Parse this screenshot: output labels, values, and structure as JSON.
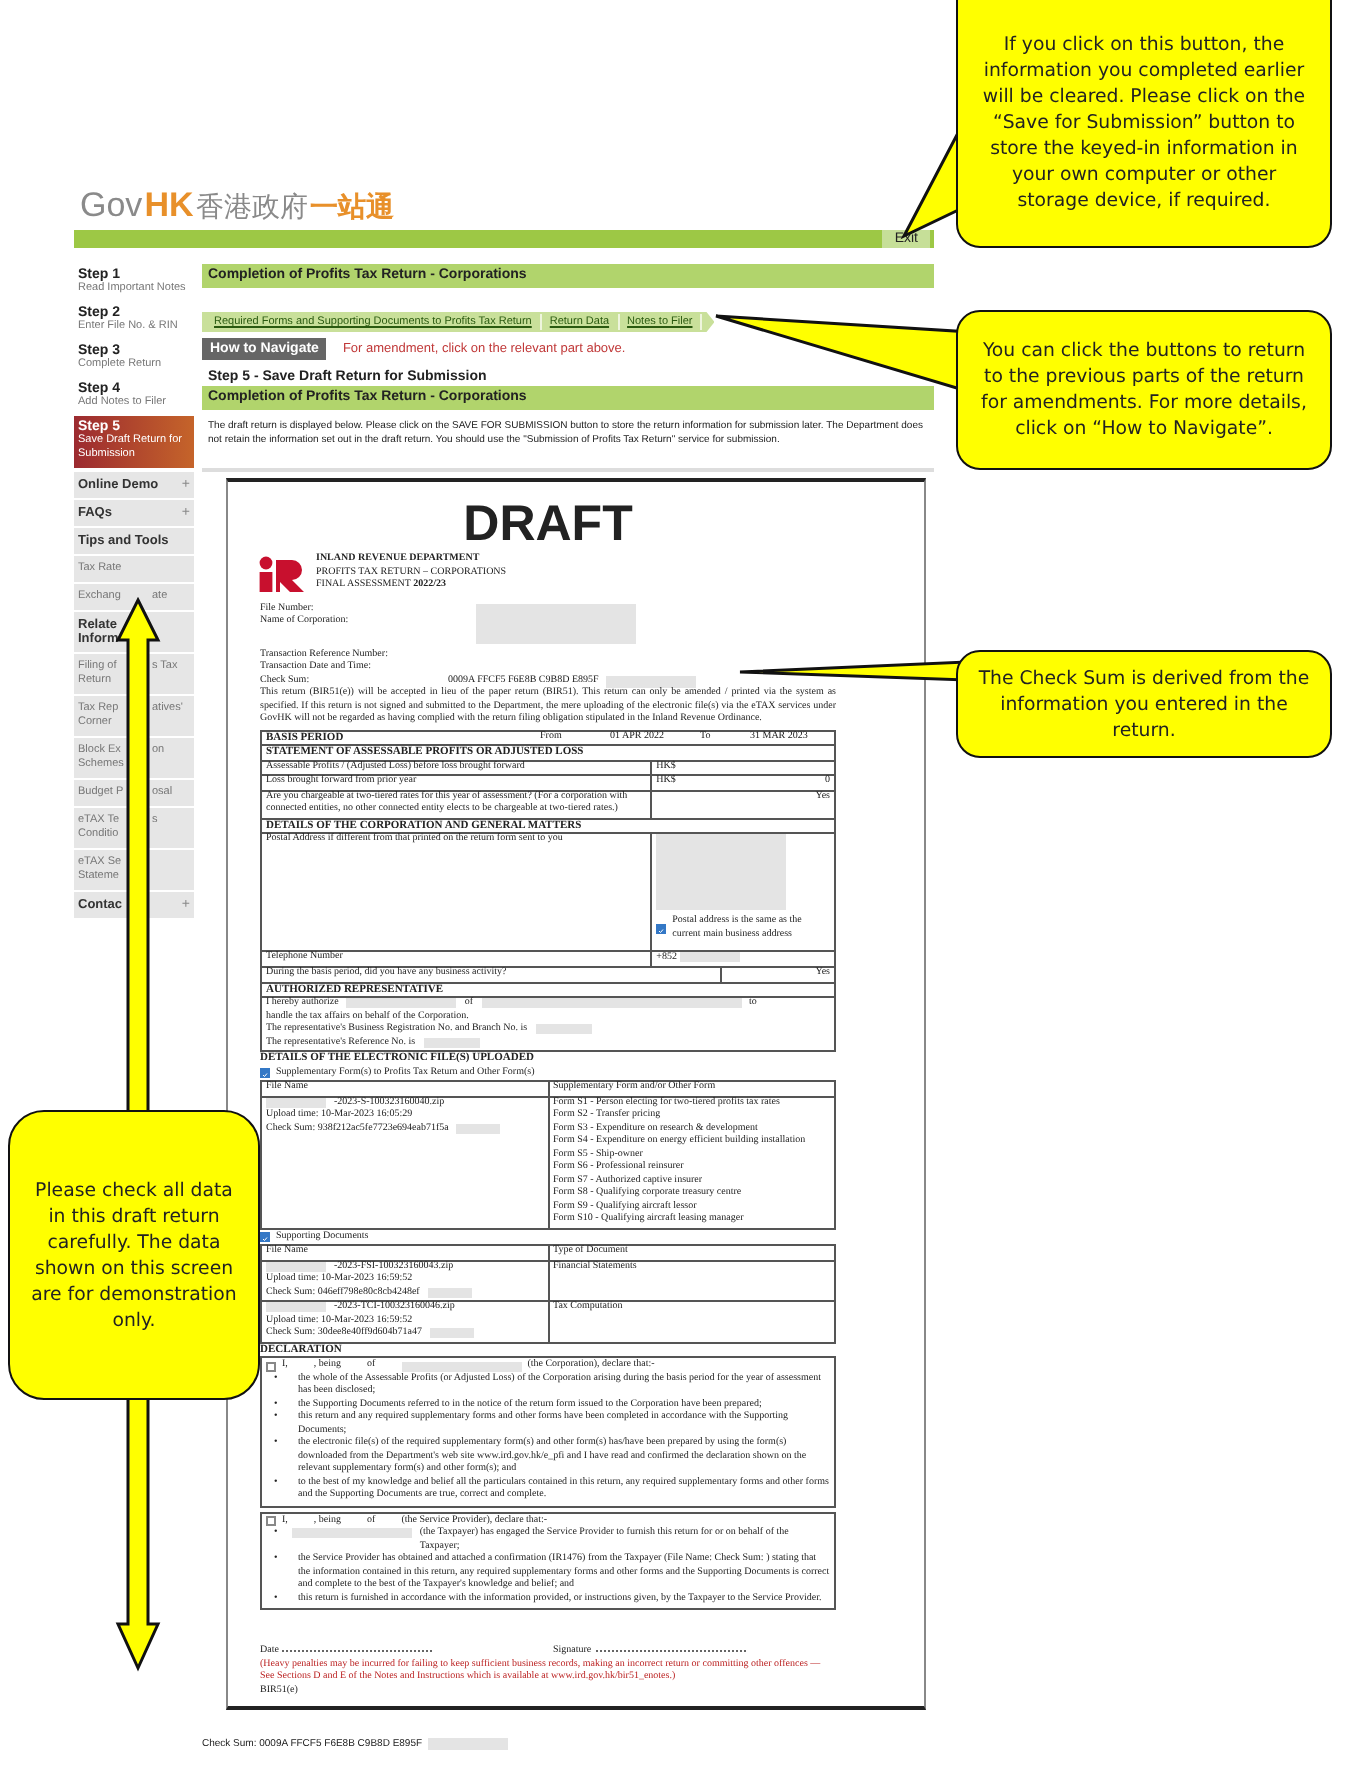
{
  "header": {
    "logo_gov": "Gov",
    "logo_hk": "HK",
    "logo_cn": "香港政府",
    "logo_cn_accent": "一站通",
    "exit": "Exit"
  },
  "sidebar": {
    "steps": [
      {
        "label": "Step 1",
        "desc": "Read Important Notes",
        "selected": false
      },
      {
        "label": "Step 2",
        "desc": "Enter File No. & RIN",
        "selected": false
      },
      {
        "label": "Step 3",
        "desc": "Complete Return",
        "selected": false
      },
      {
        "label": "Step 4",
        "desc": "Add Notes to Filer",
        "selected": false
      },
      {
        "label": "Step 5",
        "desc": "Save Draft Return for Submission",
        "selected": true
      }
    ],
    "menu": [
      {
        "kind": "heading",
        "lines": [
          [
            "Online Demo"
          ]
        ],
        "toggle": "+"
      },
      {
        "kind": "heading",
        "lines": [
          [
            "FAQs"
          ]
        ],
        "toggle": "+"
      },
      {
        "kind": "heading",
        "lines": [
          [
            "Tips and Tools"
          ]
        ]
      },
      {
        "kind": "link",
        "lines": [
          [
            "Tax Rate"
          ]
        ]
      },
      {
        "kind": "link",
        "lines": [
          [
            "Exchang",
            "ate"
          ]
        ]
      },
      {
        "kind": "heading",
        "lines": [
          [
            "Relate"
          ],
          [
            "Inform"
          ]
        ]
      },
      {
        "kind": "link",
        "lines": [
          [
            "Filing of",
            "s Tax"
          ],
          [
            "Return"
          ]
        ]
      },
      {
        "kind": "link",
        "lines": [
          [
            "Tax Rep",
            "atives'"
          ],
          [
            "Corner"
          ]
        ]
      },
      {
        "kind": "link",
        "lines": [
          [
            "Block Ex",
            "on"
          ],
          [
            "Schemes"
          ]
        ]
      },
      {
        "kind": "link",
        "lines": [
          [
            "Budget P",
            "osal"
          ]
        ]
      },
      {
        "kind": "link",
        "lines": [
          [
            "eTAX Te",
            "s"
          ],
          [
            "Conditio"
          ]
        ]
      },
      {
        "kind": "link",
        "lines": [
          [
            "eTAX Se"
          ],
          [
            "Stateme"
          ]
        ]
      },
      {
        "kind": "heading",
        "lines": [
          [
            "Contac"
          ]
        ],
        "toggle": "+"
      }
    ]
  },
  "main": {
    "page_title": "Completion of Profits Tax Return - Corporations",
    "breadcrumb": [
      "Required Forms and Supporting Documents to Profits Tax Return",
      "Return Data",
      "Notes to Filer"
    ],
    "how_button": "How to Navigate",
    "amend_hint": "For amendment, click on the relevant part above.",
    "step_title": "Step 5 - Save Draft Return for Submission",
    "section_title": "Completion of Profits Tax Return - Corporations",
    "intro": "The draft return is displayed below. Please click on the SAVE FOR SUBMISSION button to store the return information for submission later. The Department does not retain the information set out in the draft return. You should use the \"Submission of Profits Tax Return\" service for submission."
  },
  "document": {
    "watermark": "DRAFT",
    "dept": [
      "INLAND REVENUE DEPARTMENT",
      "PROFITS TAX RETURN – CORPORATIONS",
      "FINAL ASSESSMENT **2022/23**"
    ],
    "id_fields": [
      "File Number:",
      "Name of Corporation:"
    ],
    "txn_fields": [
      {
        "label": "Transaction Reference Number:"
      },
      {
        "label": "Transaction Date and Time:"
      },
      {
        "label": "Check Sum:",
        "value": "0009A FFCF5 F6E8B C9B8D E895F"
      }
    ],
    "notice": "This return (BIR51(e)) will be accepted in lieu of the paper return (BIR51). This return can only be amended / printed via the system as specified. If this return is not signed and submitted to the Department, the mere uploading of the electronic file(s) via the eTAX services under GovHK will not be regarded as having complied with the return filing obligation stipulated in the Inland Revenue Ordinance.",
    "basis": {
      "label": "BASIS PERIOD",
      "from_label": "From",
      "from": "01 APR 2022",
      "to_label": "To",
      "to": "31 MAR 2023"
    },
    "profits": {
      "heading": "STATEMENT OF ASSESSABLE PROFITS OR ADJUSTED LOSS",
      "rows": [
        {
          "label": "Assessable Profits / (Adjusted Loss) before loss brought forward",
          "unit": "HK$"
        },
        {
          "label": "Loss brought forward from prior year",
          "unit": "HK$",
          "value": "0"
        },
        {
          "label": "Are you chargeable at two-tiered rates for this year of assessment? (For a corporation with connected entities, no other connected entity elects to be chargeable at two-tiered rates.)",
          "value": "Yes"
        }
      ]
    },
    "general": {
      "heading": "DETAILS OF THE CORPORATION AND GENERAL MATTERS",
      "postal_label": "Postal Address if different from that printed on the return form sent to you",
      "postal_same": {
        "label": "Postal address is the same as the current main business address",
        "checked": true
      },
      "phone_label": "Telephone Number",
      "phone": "+852",
      "activity_q": "During the basis period, did you have any business activity?",
      "activity_a": "Yes"
    },
    "representative": {
      "heading": "AUTHORIZED REPRESENTATIVE",
      "authorize": "I hereby authorize",
      "of": "of",
      "to": "to",
      "handle": "handle the tax affairs on behalf of the Corporation.",
      "br_no": "The representative's Business Registration No. and Branch No. is",
      "ref_no": "The representative's Reference No. is"
    },
    "uploads": {
      "heading": "DETAILS OF THE ELECTRONIC FILE(S) UPLOADED",
      "groups": [
        {
          "label": "Supplementary Form(s) to Profits Tax Return and Other Form(s)",
          "checked": true,
          "col_1": "File Name",
          "col_2": "Supplementary Form and/or Other Form",
          "rows": [
            {
              "file": "-2023-S-100323160040.zip",
              "upload": "Upload time: 10-Mar-2023 16:05:29",
              "checksum": "Check Sum: 938f212ac5fe7723e694eab71f5a",
              "forms": [
                "Form S1 - Person electing for two-tiered profits tax rates",
                "Form S2 - Transfer pricing",
                "Form S3 - Expenditure on research & development",
                "Form S4 - Expenditure on energy efficient building installation",
                "Form S5 - Ship-owner",
                "Form S6 - Professional reinsurer",
                "Form S7 - Authorized captive insurer",
                "Form S8 - Qualifying corporate treasury centre",
                "Form S9 - Qualifying aircraft lessor",
                "Form S10 - Qualifying aircraft leasing manager"
              ]
            }
          ]
        },
        {
          "label": "Supporting Documents",
          "checked": true,
          "col_1": "File Name",
          "col_2": "Type of Document",
          "rows": [
            {
              "file": "-2023-FSI-100323160043.zip",
              "upload": "Upload time: 10-Mar-2023 16:59:52",
              "checksum": "Check Sum: 046eff798e80c8cb4248ef",
              "forms": [
                "Financial Statements"
              ]
            },
            {
              "file": "-2023-TCI-100323160046.zip",
              "upload": "Upload time: 10-Mar-2023 16:59:52",
              "checksum": "Check Sum: 30dee8e40ff9d604b71a47",
              "forms": [
                "Tax Computation"
              ]
            }
          ]
        }
      ]
    },
    "declaration": {
      "heading": "DECLARATION",
      "boxes": [
        {
          "checked": false,
          "marker": "•",
          "intro": [
            {
              "text": "I,"
            },
            {
              "text": ", being"
            },
            {
              "text": "of",
              "redacted": true
            },
            {
              "text": "(the Corporation), declare that:-"
            }
          ],
          "bullets": [
            {
              "text": "the whole of the Assessable Profits (or Adjusted Loss) of the Corporation arising during the basis period for the year of assessment has been disclosed;"
            },
            {
              "text": "the Supporting Documents referred to in the notice of the return form issued to the Corporation have been prepared;"
            },
            {
              "text": "this return and any required supplementary forms and other forms have been completed in accordance with the Supporting Documents;"
            },
            {
              "text": "the electronic file(s) of the required supplementary form(s) and other form(s) has/have been prepared by using the form(s) downloaded from the Department's web site www.ird.gov.hk/e_pfi and I have read and confirmed the declaration shown on the relevant supplementary form(s) and other form(s); and"
            },
            {
              "text": "to the best of my knowledge and belief all the particulars contained in this return, any required supplementary forms and other forms and the Supporting Documents are true, correct and complete."
            }
          ]
        },
        {
          "checked": false,
          "marker": "•",
          "intro": [
            {
              "text": "I,"
            },
            {
              "text": ", being"
            },
            {
              "text": "of"
            },
            {
              "text": "(the Service Provider), declare that:-"
            }
          ],
          "bullets": [
            {
              "text": "(the Taxpayer) has engaged the Service Provider to furnish this return for or on behalf of the Taxpayer;",
              "redacted": true
            },
            {
              "text": "the Service Provider has obtained and attached a confirmation (IR1476) from the Taxpayer (File Name:      Check Sum:      ) stating that the information contained in this return, any required supplementary forms and other forms and the Supporting Documents is correct and complete to the best of the Taxpayer's knowledge and belief; and"
            },
            {
              "text": "this return is furnished in accordance with the information provided, or instructions given, by the Taxpayer to the Service Provider."
            }
          ]
        }
      ]
    },
    "date_label": "Date",
    "signature_label": "Signature",
    "warning": "(Heavy penalties may be incurred for failing to keep sufficient business records, making an incorrect return or committing other offences — See Sections D and E of the Notes and Instructions which is available at www.ird.gov.hk/bir51_enotes.)",
    "form_code": "BIR51(e)"
  },
  "footer": {
    "check_sum": "Check Sum: 0009A FFCF5 F6E8B C9B8D E895F"
  },
  "callouts": [
    "If you click on this button, the information you completed earlier will be cleared.  Please click on the “Save for Submission” button to store the keyed-in information in your own computer or other storage device, if required.",
    "You can click the buttons to return to the previous parts of the return for amendments. For more details, click on “How to Navigate”.",
    "The Check Sum is derived from the information you entered in the return.",
    "Please check all data in this draft return carefully. The data shown on this screen are for demonstration only."
  ]
}
